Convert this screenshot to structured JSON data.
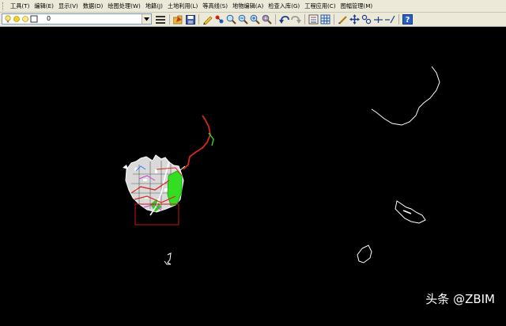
{
  "menubar": {
    "items": [
      {
        "id": "tools",
        "label": "工具(T)"
      },
      {
        "id": "edit",
        "label": "编辑(E)"
      },
      {
        "id": "display",
        "label": "显示(V)"
      },
      {
        "id": "data",
        "label": "数据(D)"
      },
      {
        "id": "draw",
        "label": "绘图处理(W)"
      },
      {
        "id": "cadastre",
        "label": "地籍(J)"
      },
      {
        "id": "landuse",
        "label": "土地利用(L)"
      },
      {
        "id": "contour",
        "label": "等高线(S)"
      },
      {
        "id": "feature-edit",
        "label": "地物编辑(A)"
      },
      {
        "id": "check",
        "label": "检查入库(G)"
      },
      {
        "id": "engineering",
        "label": "工程应用(C)"
      },
      {
        "id": "sheet",
        "label": "图幅管理(M)"
      }
    ]
  },
  "toolbar": {
    "layer_name": "0",
    "icons": [
      "layer-manager-icon",
      "open-icon",
      "save-icon",
      "pencil-icon",
      "pan-realtime-icon",
      "zoom-realtime-icon",
      "zoom-window-icon",
      "zoom-previous-icon",
      "zoom-all-icon",
      "undo-icon",
      "redo-icon",
      "properties-icon",
      "grid-icon",
      "draw-icon",
      "move-icon",
      "rotate-icon",
      "line-icon",
      "polyline-icon",
      "help-icon"
    ]
  },
  "watermark": {
    "text": "头条 @ZBIM"
  },
  "colors": {
    "canvas_bg": "#000000",
    "ui_bg": "#ece9d8",
    "red_line": "#d42a1e",
    "green_area": "#33dd22"
  }
}
